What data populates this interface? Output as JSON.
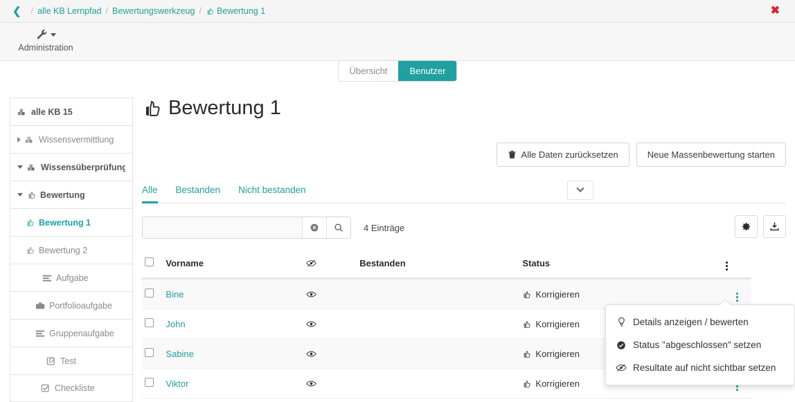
{
  "breadcrumb": {
    "back_icon": "chevron-left-icon",
    "separator": "/",
    "items": [
      {
        "label": "alle KB Lernpfad",
        "icon": ""
      },
      {
        "label": "Bewertungswerkzeug",
        "icon": ""
      },
      {
        "label": "Bewertung 1",
        "icon": "thumbs-up-icon"
      }
    ],
    "close_label": "✖"
  },
  "toolbar": {
    "administration_label": "Administration",
    "administration_icon": "wrench-icon"
  },
  "tabs": [
    {
      "label": "Übersicht",
      "active": false
    },
    {
      "label": "Benutzer",
      "active": true
    }
  ],
  "sidebar": {
    "items": [
      {
        "label": "alle KB 15",
        "icon": "cubes-icon",
        "indent": 0,
        "arrow": "none",
        "style": "root"
      },
      {
        "label": "Wissensvermittlung",
        "icon": "cubes-icon",
        "indent": 0,
        "arrow": "right",
        "style": "normal"
      },
      {
        "label": "Wissensüberprüfung",
        "icon": "cubes-icon",
        "indent": 0,
        "arrow": "down",
        "style": "bold"
      },
      {
        "label": "Bewertung",
        "icon": "thumbs-up-icon",
        "indent": 1,
        "arrow": "down",
        "style": "bold"
      },
      {
        "label": "Bewertung 1",
        "icon": "thumbs-up-icon",
        "indent": 2,
        "arrow": "none",
        "style": "active"
      },
      {
        "label": "Bewertung 2",
        "icon": "thumbs-up-icon",
        "indent": 2,
        "arrow": "none",
        "style": "normal"
      },
      {
        "label": "Aufgabe",
        "icon": "tasks-icon",
        "indent": 1,
        "arrow": "none",
        "style": "normal"
      },
      {
        "label": "Portfolioaufgabe",
        "icon": "briefcase-icon",
        "indent": 1,
        "arrow": "none",
        "style": "normal"
      },
      {
        "label": "Gruppenaufgabe",
        "icon": "tasks-icon",
        "indent": 1,
        "arrow": "none",
        "style": "normal"
      },
      {
        "label": "Test",
        "icon": "edit-icon",
        "indent": 1,
        "arrow": "none",
        "style": "normal"
      },
      {
        "label": "Checkliste",
        "icon": "check-square-icon",
        "indent": 1,
        "arrow": "none",
        "style": "normal"
      }
    ]
  },
  "main": {
    "title": "Bewertung 1",
    "title_icon": "thumbs-up-icon",
    "actions": [
      {
        "label": "Alle Daten zurücksetzen",
        "icon": "trash-icon"
      },
      {
        "label": "Neue Massenbewertung starten",
        "icon": ""
      }
    ],
    "filter_tabs": [
      {
        "label": "Alle",
        "active": true
      },
      {
        "label": "Bestanden",
        "active": false
      },
      {
        "label": "Nicht bestanden",
        "active": false
      }
    ],
    "search": {
      "value": "",
      "placeholder": ""
    },
    "clear_icon": "times-circle-icon",
    "search_icon": "search-icon",
    "entries_count": "4 Einträge",
    "tool_buttons": [
      {
        "icon": "gear-icon"
      },
      {
        "icon": "download-icon"
      }
    ],
    "table": {
      "columns": [
        {
          "label": "",
          "kind": "checkbox"
        },
        {
          "label": "Vorname",
          "kind": "text"
        },
        {
          "label": "",
          "kind": "eye-slash"
        },
        {
          "label": "Bestanden",
          "kind": "text"
        },
        {
          "label": "Status",
          "kind": "text"
        },
        {
          "label": "",
          "kind": "menu"
        }
      ],
      "rows": [
        {
          "name": "Bine",
          "eye": "eye-icon",
          "bestanden": "",
          "status": "Korrigieren",
          "status_icon": "thumbs-up-icon"
        },
        {
          "name": "John",
          "eye": "eye-icon",
          "bestanden": "",
          "status": "Korrigieren",
          "status_icon": "thumbs-up-icon"
        },
        {
          "name": "Sabine",
          "eye": "eye-icon",
          "bestanden": "",
          "status": "Korrigieren",
          "status_icon": "thumbs-up-icon"
        },
        {
          "name": "Viktor",
          "eye": "eye-icon",
          "bestanden": "",
          "status": "Korrigieren",
          "status_icon": "thumbs-up-icon"
        }
      ]
    },
    "dropdown": {
      "items": [
        {
          "label": "Details anzeigen / bewerten",
          "icon": "lightbulb-icon"
        },
        {
          "label": "Status \"abgeschlossen\" setzen",
          "icon": "check-circle-icon"
        },
        {
          "label": "Resultate auf nicht sichtbar setzen",
          "icon": "eye-slash-icon"
        }
      ]
    }
  },
  "colors": {
    "accent": "#20a0a0",
    "close_red": "#d9232d",
    "text": "#333333",
    "muted": "#8a8a8a"
  }
}
